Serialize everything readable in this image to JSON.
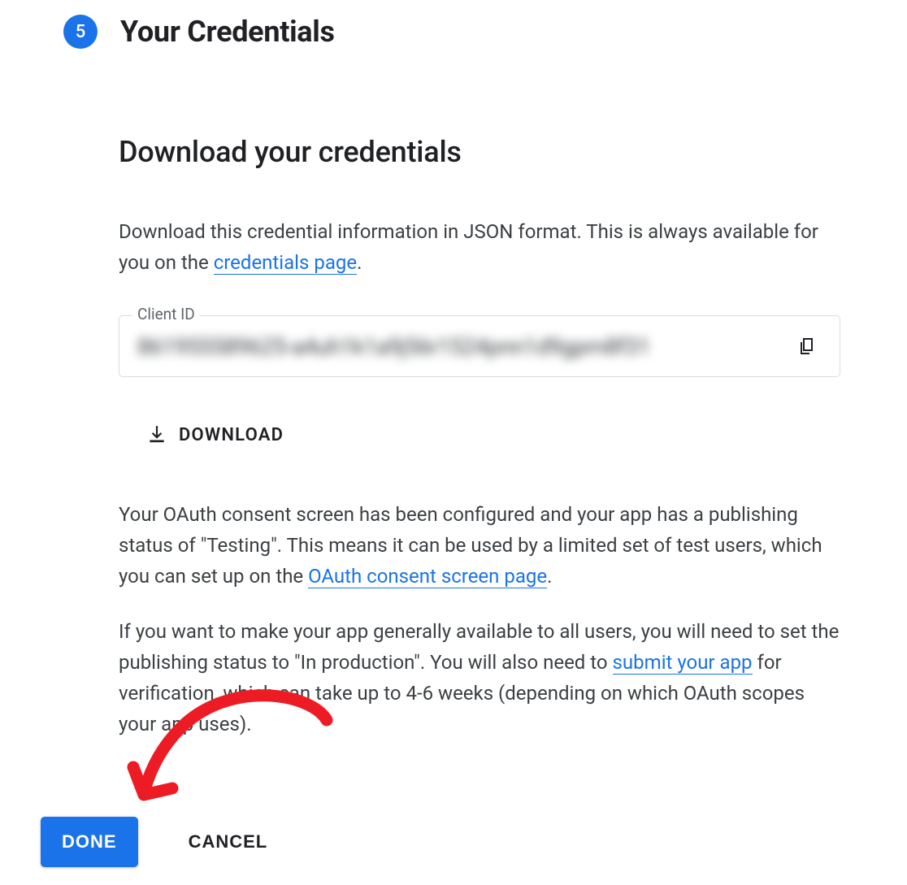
{
  "step": {
    "number": "5",
    "title": "Your Credentials"
  },
  "section": {
    "heading": "Download your credentials",
    "intro_pre": "Download this credential information in JSON format. This is always available for you on the ",
    "intro_link": "credentials page",
    "intro_post": "."
  },
  "client_id": {
    "label": "Client ID",
    "value": "861955589625-a4uh1k1a9j56r1524pnn1d9gpm8f31"
  },
  "download_button": "DOWNLOAD",
  "para1": {
    "pre": "Your OAuth consent screen has been configured and your app has a publishing status of \"Testing\". This means it can be used by a limited set of test users, which you can set up on the ",
    "link": "OAuth consent screen page",
    "post": "."
  },
  "para2": {
    "pre": "If you want to make your app generally available to all users, you will need to set the publishing status to \"In production\". You will also need to ",
    "link": "submit your app",
    "post": " for verification, which can take up to 4-6 weeks (depending on which OAuth scopes your app uses)."
  },
  "actions": {
    "done": "DONE",
    "cancel": "CANCEL"
  },
  "colors": {
    "primary": "#1a73e8",
    "annotation": "#ed1c24"
  }
}
